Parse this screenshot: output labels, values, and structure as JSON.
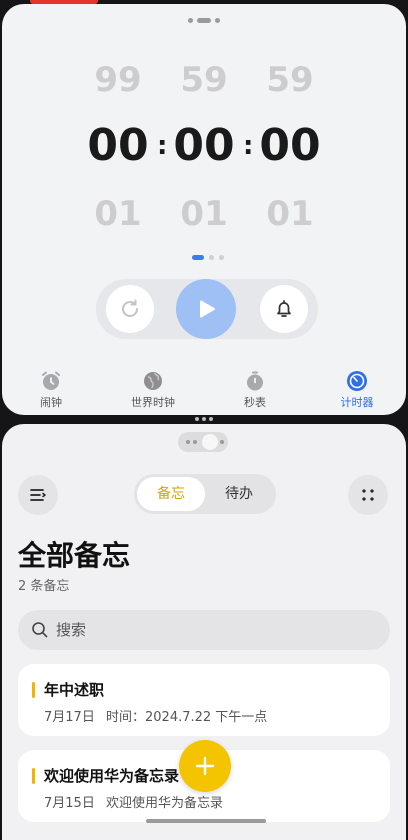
{
  "clock": {
    "picker": {
      "prev": {
        "hours": "99",
        "minutes": "59",
        "seconds": "59"
      },
      "current": {
        "hours": "00",
        "minutes": "00",
        "seconds": "00"
      },
      "next": {
        "hours": "01",
        "minutes": "01",
        "seconds": "01"
      },
      "separator": ":"
    },
    "page_indicator": {
      "pages": 3,
      "active": 1
    },
    "controls": {
      "reset_icon": "reset-icon",
      "play_icon": "play-icon",
      "alarm_icon": "bell-icon",
      "play_color": "#9ec0f5"
    },
    "tabs": [
      {
        "label": "闹钟",
        "icon": "alarm-clock-icon"
      },
      {
        "label": "世界时钟",
        "icon": "globe-icon"
      },
      {
        "label": "秒表",
        "icon": "stopwatch-icon"
      },
      {
        "label": "计时器",
        "icon": "timer-icon",
        "active": true
      }
    ],
    "accent": "#2f6fe8"
  },
  "notes": {
    "segments": {
      "notes_label": "备忘",
      "todo_label": "待办",
      "active": "备忘"
    },
    "title": "全部备忘",
    "count": "2 条备忘",
    "search_placeholder": "搜索",
    "items": [
      {
        "title": "年中述职",
        "date": "7月17日",
        "snippet": "时间：2024.7.22 下午一点"
      },
      {
        "title": "欢迎使用华为备忘录",
        "date": "7月15日",
        "snippet": "欢迎使用华为备忘录"
      }
    ],
    "accent": "#f5c400"
  }
}
